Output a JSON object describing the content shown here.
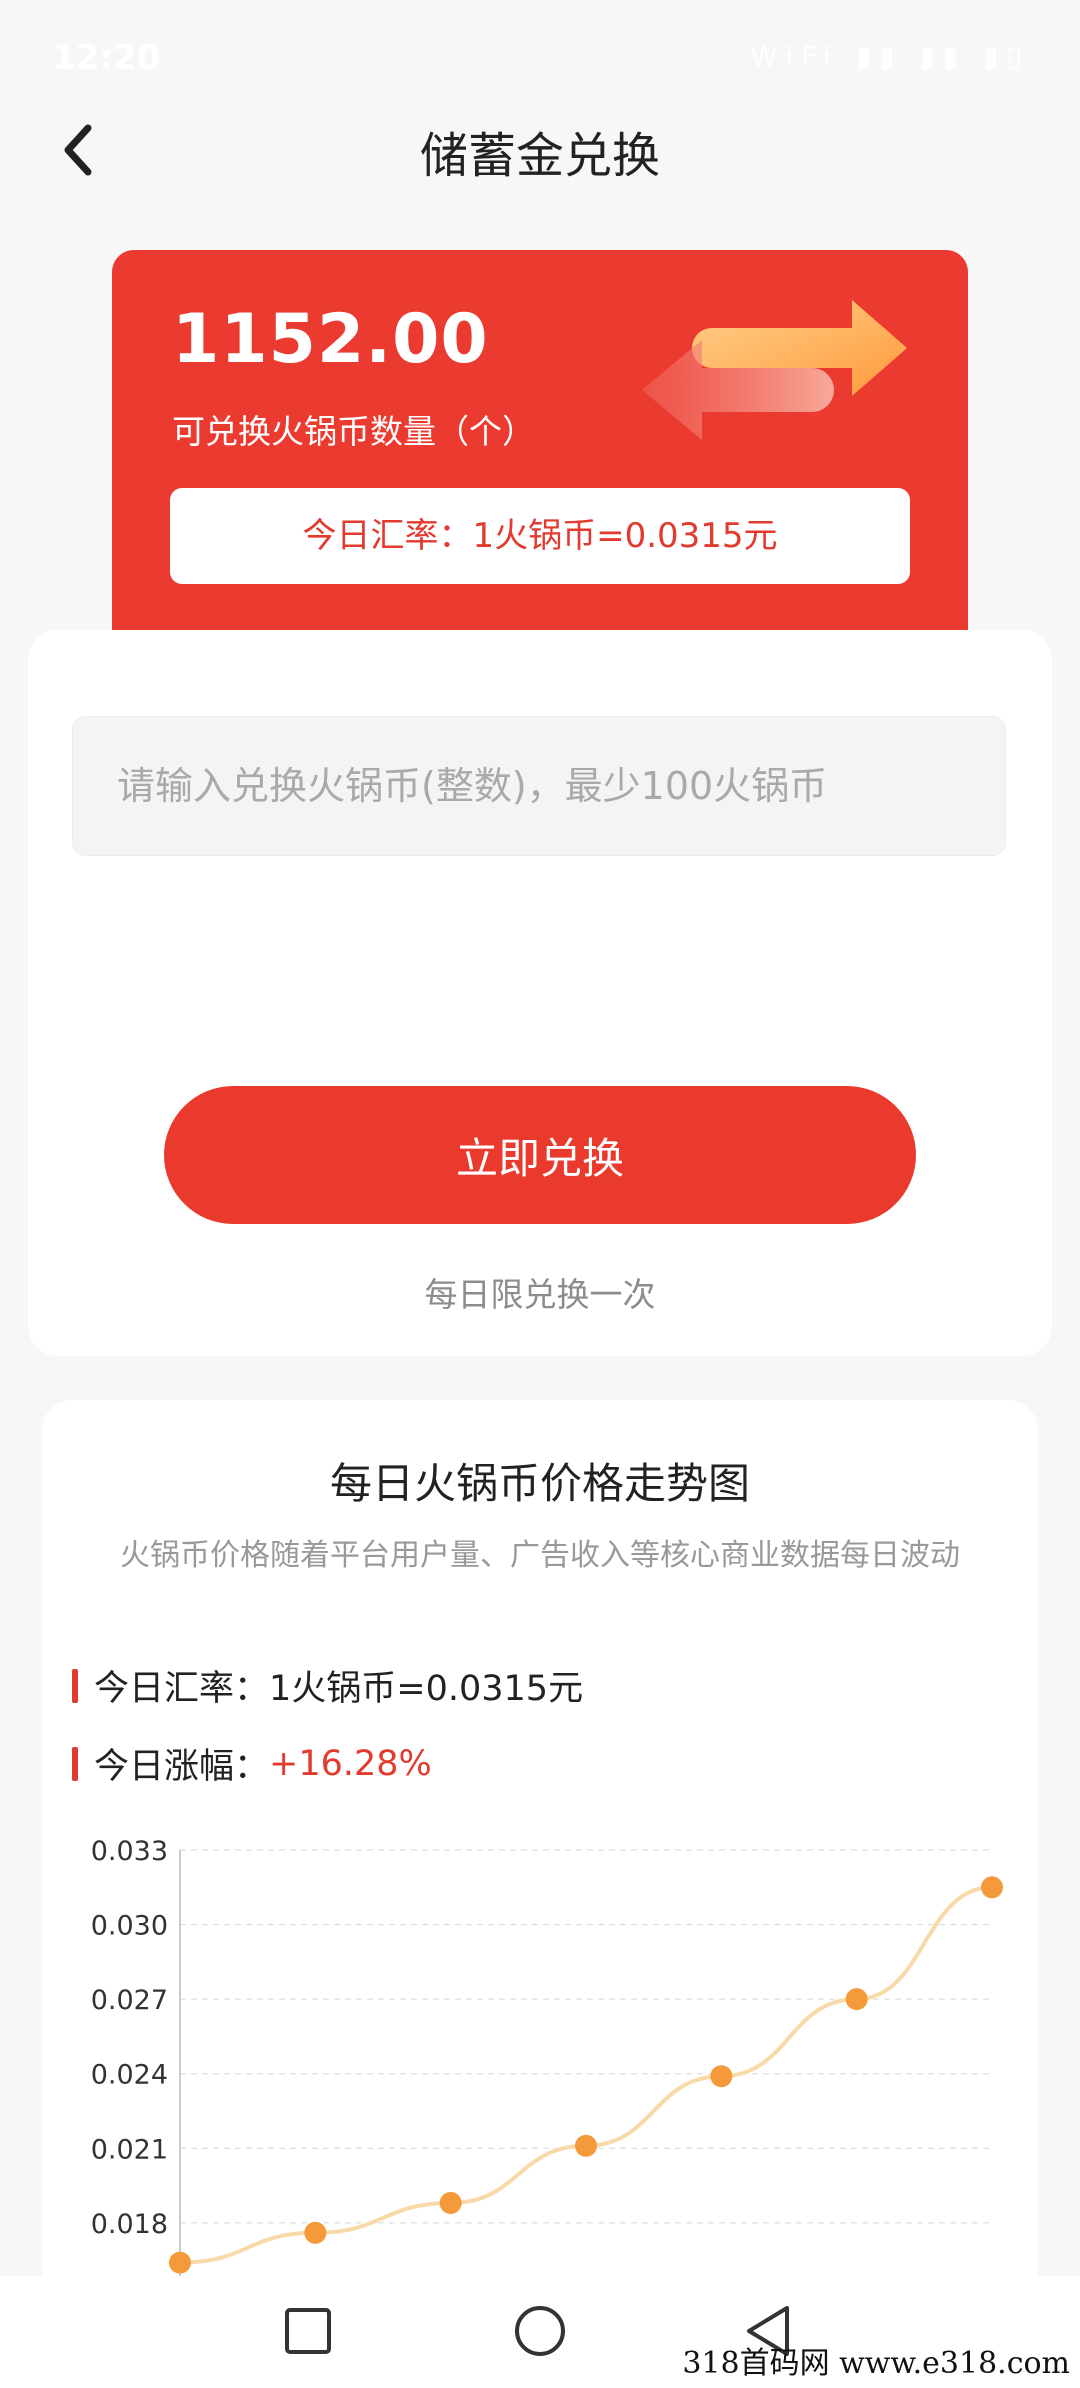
{
  "status_bar": {
    "time": "12:20",
    "icons_text": "WiFi ▮▮ ▮▮ ▮▯"
  },
  "header": {
    "title": "储蓄金兑换"
  },
  "balance": {
    "amount": "1152.00",
    "label": "可兑换火锅币数量（个）",
    "rate_text": "今日汇率：1火锅币=0.0315元"
  },
  "form": {
    "input_placeholder": "请输入兑换火锅币(整数)，最少100火锅币",
    "submit_label": "立即兑换",
    "note": "每日限兑换一次"
  },
  "trend": {
    "title": "每日火锅币价格走势图",
    "subtitle": "火锅币价格随着平台用户量、广告收入等核心商业数据每日波动",
    "rate_label": "今日汇率：",
    "rate_value": "1火锅币=0.0315元",
    "change_label": "今日涨幅：",
    "change_value": "+16.28%"
  },
  "chart_data": {
    "type": "line",
    "y_ticks": [
      "0.033",
      "0.030",
      "0.027",
      "0.024",
      "0.021",
      "0.018"
    ],
    "ylim": [
      0.0155,
      0.033
    ],
    "x": [
      1,
      2,
      3,
      4,
      5,
      6,
      7
    ],
    "values": [
      0.0164,
      0.0176,
      0.0188,
      0.0211,
      0.0239,
      0.027,
      0.0315
    ],
    "grid": true,
    "line_color": "#f8d9a8",
    "point_color": "#f59a3b"
  },
  "colors": {
    "brand_red": "#eb3a2f",
    "accent_orange": "#f59a3b"
  },
  "watermark": "318首码网  www.e318.com",
  "navbar": {
    "icons": [
      "square-icon",
      "circle-icon",
      "triangle-back-icon"
    ]
  }
}
